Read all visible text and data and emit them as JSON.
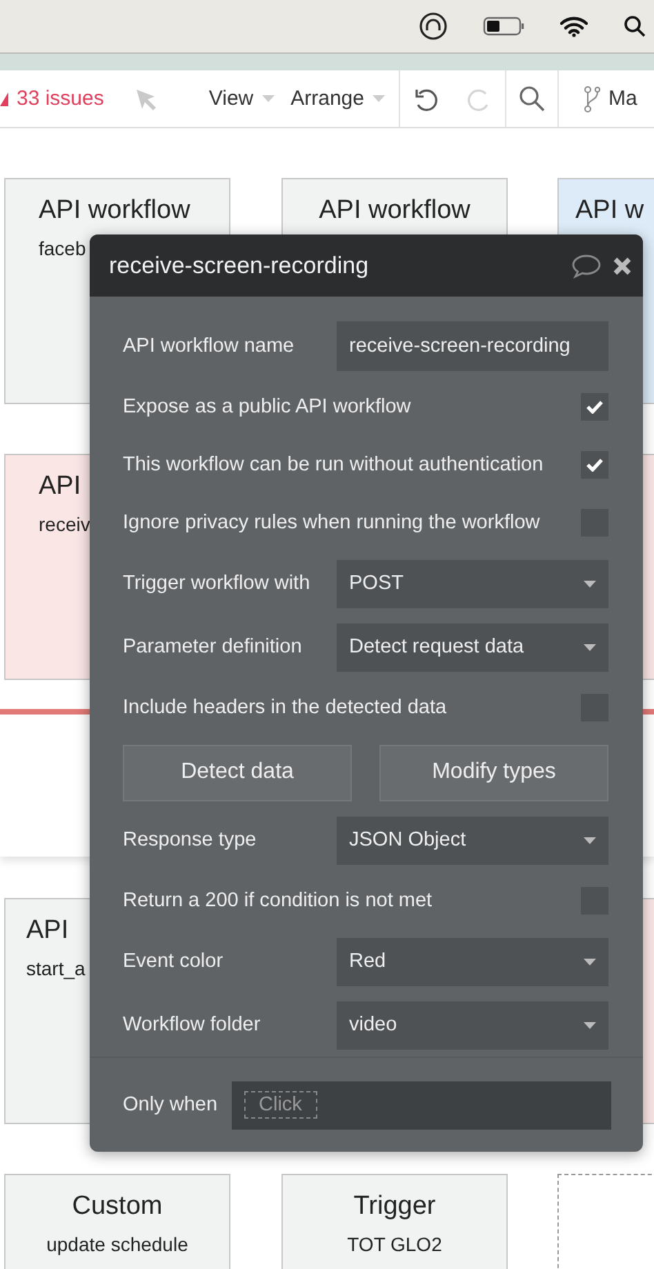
{
  "toolbar": {
    "issues": "33 issues",
    "menus": [
      {
        "label": "View"
      },
      {
        "label": "Arrange"
      }
    ],
    "undo_enabled": true,
    "redo_enabled": false,
    "branch": "Ma"
  },
  "canvas": {
    "cards": [
      {
        "kind": "workflow",
        "color": "#f1f2f2",
        "title": "API workflow",
        "subtitle": "faceb"
      },
      {
        "kind": "workflow",
        "color": "#f1f2f2",
        "title": "API workflow"
      },
      {
        "kind": "workflow",
        "color": "#dcebf7",
        "title": "API w"
      },
      {
        "kind": "workflow",
        "color": "#fbe6e6",
        "title": "API",
        "subtitle": "receiv"
      },
      {
        "kind": "workflow",
        "color": "#fbe6e6"
      },
      {
        "kind": "workflow",
        "color": "#f1f2f2",
        "title": "API",
        "subtitle": "start_a"
      },
      {
        "kind": "workflow",
        "color": "#fbe6e6"
      },
      {
        "kind": "workflow",
        "color": "#f1f2f2",
        "title": "Custom",
        "subtitle": "update schedule"
      },
      {
        "kind": "workflow",
        "color": "#f1f2f2",
        "title": "Trigger",
        "subtitle": "TOT GLO2"
      },
      {
        "kind": "placeholder",
        "color": "#ffffff"
      }
    ]
  },
  "dialog": {
    "title": "receive-screen-recording",
    "rows": [
      {
        "kind": "text",
        "label": "API workflow name",
        "value": "receive-screen-recording"
      },
      {
        "kind": "checkbox",
        "label": "Expose as a public API workflow",
        "checked": true
      },
      {
        "kind": "checkbox",
        "label": "This workflow can be run without authentication",
        "checked": true
      },
      {
        "kind": "checkbox",
        "label": "Ignore privacy rules when running the workflow",
        "checked": false
      },
      {
        "kind": "dropdown",
        "label": "Trigger workflow with",
        "value": "POST"
      },
      {
        "kind": "dropdown",
        "label": "Parameter definition",
        "value": "Detect request data"
      },
      {
        "kind": "checkbox",
        "label": "Include headers in the detected data",
        "checked": false
      },
      {
        "kind": "buttons",
        "buttons": [
          "Detect data",
          "Modify types"
        ]
      },
      {
        "kind": "dropdown",
        "label": "Response type",
        "value": "JSON Object"
      },
      {
        "kind": "checkbox",
        "label": "Return a 200 if condition is not met",
        "checked": false
      },
      {
        "kind": "dropdown",
        "label": "Event color",
        "value": "Red"
      },
      {
        "kind": "dropdown",
        "label": "Workflow folder",
        "value": "video"
      }
    ],
    "only_when": {
      "label": "Only when",
      "placeholder": "Click"
    }
  }
}
